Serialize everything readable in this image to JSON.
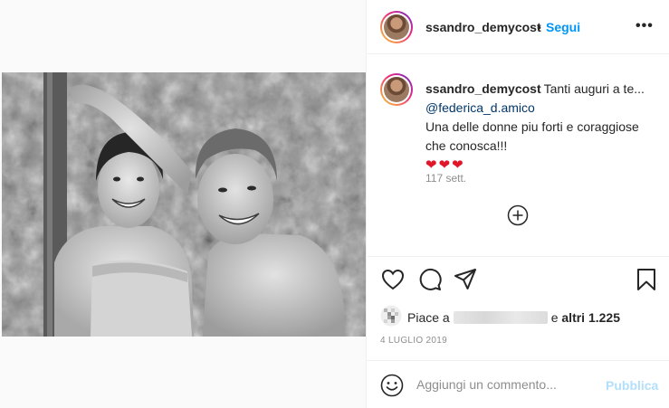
{
  "post": {
    "username": "ssandro_demycost",
    "dot": "•",
    "follow_label": "Segui",
    "more_label": "•••",
    "caption": {
      "username": "ssandro_demycost",
      "line1": "Tanti auguri a te...",
      "mention": "@federica_d.amico",
      "line3": "Una delle donne piu forti e coraggiose che conosca!!!",
      "hearts": "❤❤❤"
    },
    "time_ago": "117 sett.",
    "likes": {
      "prefix": "Piace a",
      "suffix_connector": "e",
      "suffix_count": "altri 1.225"
    },
    "date": "4 LUGLIO 2019",
    "comment": {
      "placeholder": "Aggiungi un commento...",
      "publish_label": "Pubblica"
    }
  },
  "icons": {
    "more": "more-options-icon",
    "load_more": "plus-circle-icon",
    "like": "heart-icon",
    "comment": "comment-icon",
    "share": "paper-plane-icon",
    "save": "bookmark-icon",
    "emoji": "emoji-smile-icon"
  },
  "colors": {
    "accent": "#0095f6",
    "mention": "#00376b",
    "hearts": "#e0162b",
    "publish_disabled": "#b2dffc",
    "muted": "#8e8e8e"
  }
}
